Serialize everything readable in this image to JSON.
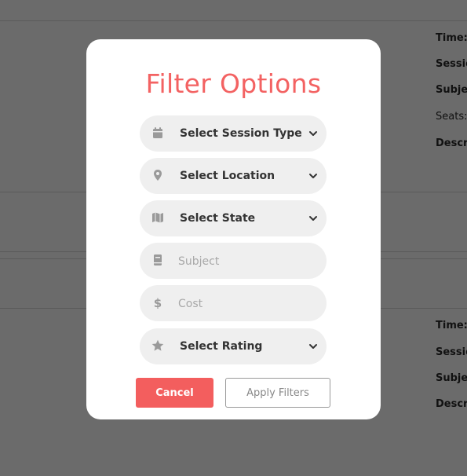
{
  "background": {
    "card1": {
      "time": "Time:",
      "session": "Sessio",
      "subject": "Subjec",
      "seats": "Seats:",
      "description": "Descr"
    },
    "card2": {
      "time": "Time:",
      "session": "Sessio",
      "subject": "Subjec",
      "description": "Descr"
    }
  },
  "modal": {
    "title": "Filter Options",
    "session_type": {
      "label": "Select Session Type",
      "icon": "calendar-icon"
    },
    "location": {
      "label": "Select Location",
      "icon": "map-pin-icon"
    },
    "state": {
      "label": "Select State",
      "icon": "map-icon"
    },
    "subject": {
      "placeholder": "Subject",
      "icon": "book-icon"
    },
    "cost": {
      "placeholder": "Cost",
      "icon": "dollar-icon"
    },
    "rating": {
      "label": "Select Rating",
      "icon": "star-icon"
    },
    "cancel_label": "Cancel",
    "apply_label": "Apply Filters"
  },
  "colors": {
    "accent": "#f36262",
    "overlay": "#6b6b6b",
    "pill_bg": "#efefef",
    "icon": "#9a9a9a"
  }
}
